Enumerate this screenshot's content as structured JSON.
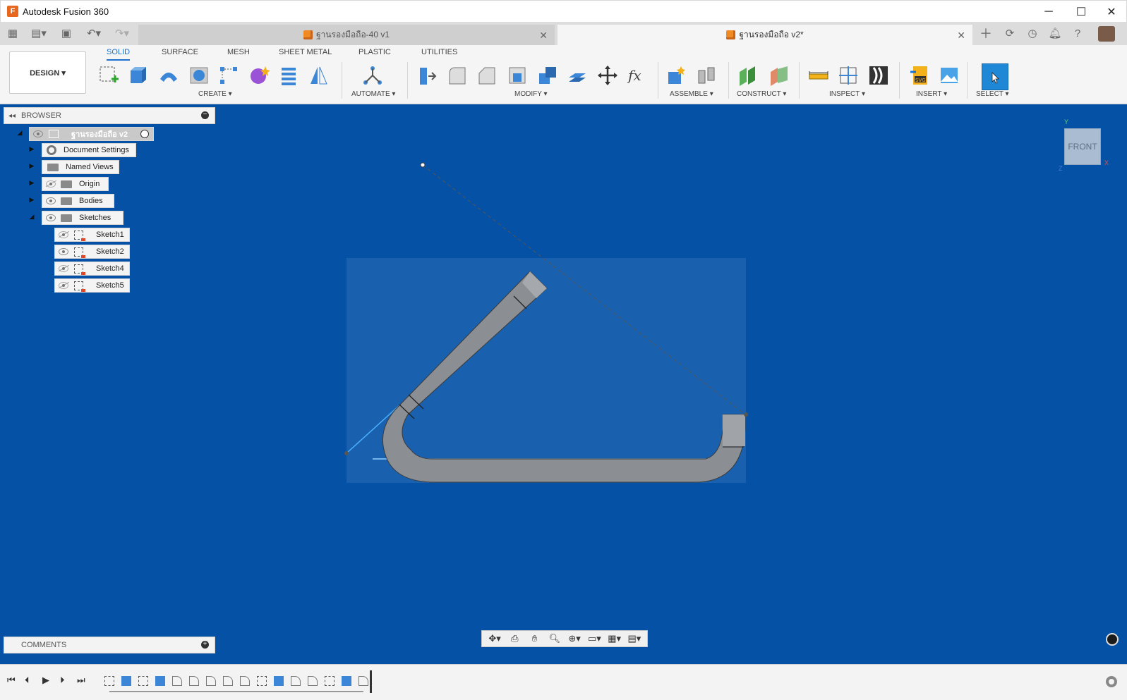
{
  "window": {
    "title": "Autodesk Fusion 360",
    "logo_letter": "F",
    "minimize": "─",
    "maximize": "☐",
    "close": "✕"
  },
  "tabs": [
    {
      "label": "ฐานรองมือถือ-40 v1",
      "active": false
    },
    {
      "label": "ฐานรองมือถือ v2*",
      "active": true
    }
  ],
  "toolbar": {
    "workspace_button": "DESIGN ▾",
    "workspace_tabs": [
      "SOLID",
      "SURFACE",
      "MESH",
      "SHEET METAL",
      "PLASTIC",
      "UTILITIES"
    ],
    "groups": [
      "CREATE ▾",
      "AUTOMATE ▾",
      "MODIFY ▾",
      "ASSEMBLE ▾",
      "CONSTRUCT ▾",
      "INSPECT ▾",
      "INSERT ▾",
      "SELECT ▾"
    ]
  },
  "browser": {
    "title": "BROWSER",
    "root": "ฐานรองมือถือ v2",
    "items": [
      {
        "label": "Document Settings"
      },
      {
        "label": "Named Views"
      },
      {
        "label": "Origin"
      },
      {
        "label": "Bodies"
      },
      {
        "label": "Sketches"
      }
    ],
    "sketches": [
      "Sketch1",
      "Sketch2",
      "Sketch4",
      "Sketch5"
    ]
  },
  "comments": {
    "title": "COMMENTS"
  },
  "viewcube": {
    "face": "FRONT",
    "axis_y": "Y",
    "axis_x": "X",
    "axis_z": "Z"
  },
  "colors": {
    "viewport": "#0451a5",
    "body": "#8b8f94",
    "accent": "#1a6fcf"
  }
}
